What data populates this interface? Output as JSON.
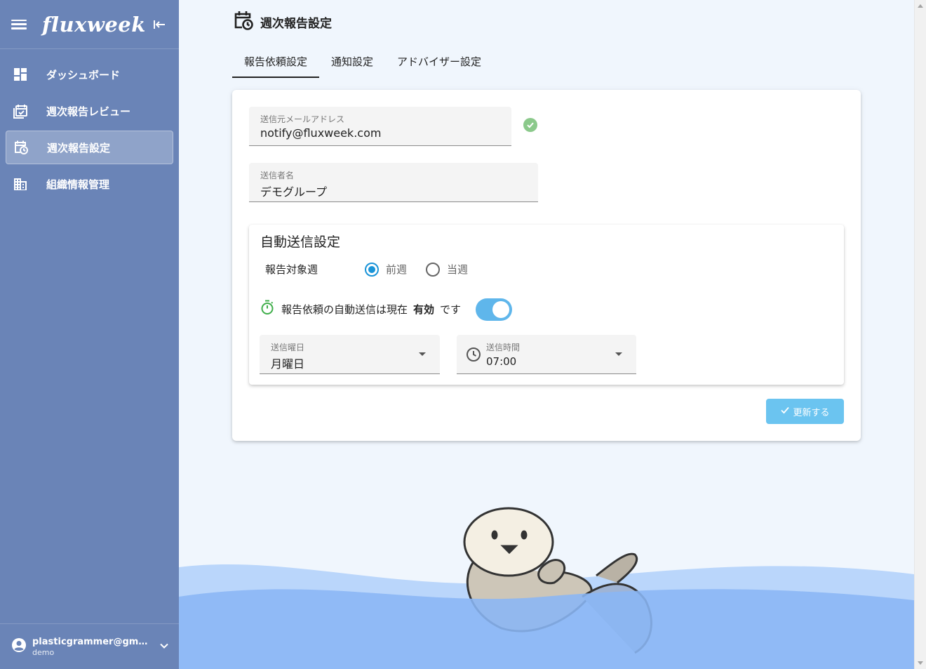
{
  "app": {
    "logo": "fluxweek"
  },
  "sidebar": {
    "items": [
      {
        "label": "ダッシュボード",
        "icon": "dashboard-icon",
        "active": false
      },
      {
        "label": "週次報告レビュー",
        "icon": "calendar-check-icon",
        "active": false
      },
      {
        "label": "週次報告設定",
        "icon": "calendar-clock-icon",
        "active": true
      },
      {
        "label": "組織情報管理",
        "icon": "building-icon",
        "active": false
      }
    ],
    "user": {
      "email": "plasticgrammer@gmail.com",
      "role": "demo"
    }
  },
  "page": {
    "title": "週次報告設定",
    "tabs": [
      {
        "label": "報告依頼設定",
        "active": true
      },
      {
        "label": "通知設定",
        "active": false
      },
      {
        "label": "アドバイザー設定",
        "active": false
      }
    ]
  },
  "form": {
    "sender_email": {
      "label": "送信元メールアドレス",
      "value": "notify@fluxweek.com",
      "verified": true
    },
    "sender_name": {
      "label": "送信者名",
      "value": "デモグループ"
    },
    "auto": {
      "title": "自動送信設定",
      "target_week_label": "報告対象週",
      "options": [
        {
          "label": "前週",
          "selected": true
        },
        {
          "label": "当週",
          "selected": false
        }
      ],
      "status_prefix": "報告依頼の自動送信は現在",
      "status_value": "有効",
      "status_suffix": "です",
      "enabled": true,
      "day": {
        "label": "送信曜日",
        "value": "月曜日"
      },
      "time": {
        "label": "送信時間",
        "value": "07:00"
      }
    },
    "update_button": "更新する"
  },
  "colors": {
    "sidebar_bg": "#6a84b7",
    "accent": "#1a94d8",
    "toggle_on": "#5fb6eb",
    "button_bg": "#6bc4f0",
    "success": "#8bc98b",
    "timer_green": "#3fae4a",
    "water_front": "#8ab6f5"
  }
}
